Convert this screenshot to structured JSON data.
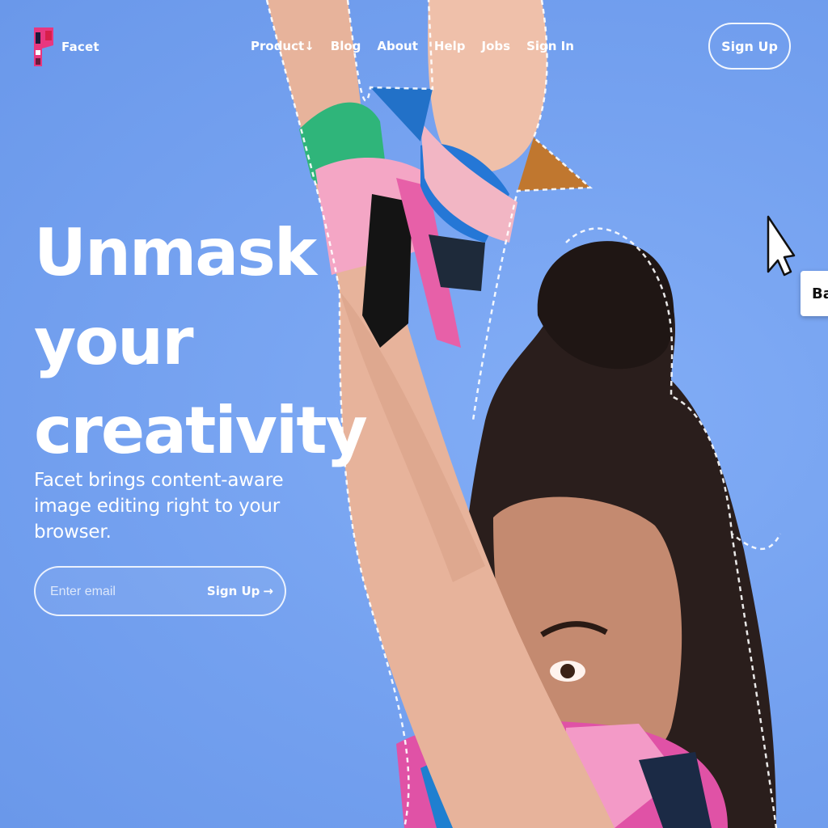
{
  "brand": {
    "name": "Facet"
  },
  "nav": {
    "items": [
      "Product",
      "Blog",
      "About",
      "Help",
      "Jobs",
      "Sign In"
    ],
    "product_arrow": "↓"
  },
  "header": {
    "signup_label": "Sign Up"
  },
  "hero": {
    "headline_lines": [
      "Unmask",
      "your",
      "creativity"
    ],
    "subtitle": "Facet brings content-aware image editing right to your browser.",
    "email_placeholder": "Enter email",
    "email_submit_label": "Sign Up",
    "email_submit_arrow": "→"
  },
  "edge_popup": {
    "label": "Ba"
  },
  "colors": {
    "background": "#7aa5f0",
    "text": "#ffffff",
    "logo_pink": "#e8377f",
    "logo_red": "#d81f4a"
  },
  "icons": [
    "facet-logo-icon",
    "down-arrow-icon",
    "right-arrow-icon",
    "mouse-cursor-icon"
  ]
}
